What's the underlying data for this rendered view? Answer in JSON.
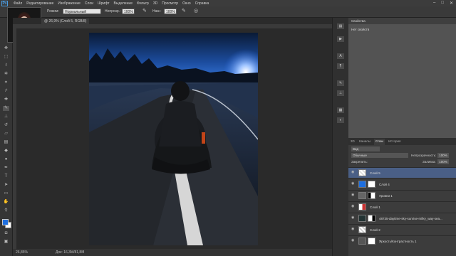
{
  "menu": {
    "logo": "Ps",
    "items": [
      "Файл",
      "Редактирование",
      "Изображение",
      "Слои",
      "Шрифт",
      "Выделение",
      "Фильтр",
      "3D",
      "Просмотр",
      "Окно",
      "Справка"
    ],
    "window_controls": [
      "–",
      "□",
      "✕"
    ]
  },
  "options": {
    "mode_label": "Режим:",
    "mode_value": "Нормальный",
    "opacity_label": "Непрозр.:",
    "opacity_value": "100%",
    "flow_label": "Наж.:",
    "flow_value": "100%"
  },
  "document": {
    "tab_title": "@ 26,9% (Слой 5, RGB/8)",
    "zoom": "26,85%",
    "doc_info": "Док: 16,3M/81,8M"
  },
  "properties": {
    "tab": "Свойства",
    "empty_text": "Нет свойств"
  },
  "layers": {
    "tabs": [
      "3D",
      "Каналы",
      "Слои",
      "История"
    ],
    "active_tab": "Слои",
    "filter": "Вид",
    "blend_mode": "Обычные",
    "opacity_label": "Непрозрачность:",
    "opacity_value": "100%",
    "lock_label": "Закрепить:",
    "fill_label": "Заливка:",
    "fill_value": "100%",
    "rows": [
      {
        "name": "Слой 5",
        "selected": true
      },
      {
        "name": "Слой 4",
        "selected": false
      },
      {
        "name": "Уровни 1",
        "selected": false
      },
      {
        "name": "Слой 1",
        "selected": false
      },
      {
        "name": "48735-daytime-sky-sunrise-milky_way-sea...",
        "selected": false
      },
      {
        "name": "Слой 2",
        "selected": false
      },
      {
        "name": "Яркость/Контрастность 1",
        "selected": false
      }
    ]
  },
  "colors": {
    "foreground": "#1e6fe0",
    "background": "#ffffff",
    "selection": "#4a5f86"
  }
}
